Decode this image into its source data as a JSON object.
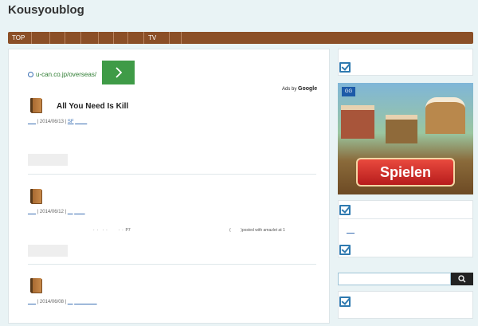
{
  "site": {
    "title": "Kousyoublog"
  },
  "nav": {
    "items": [
      "TOP",
      "",
      "",
      "",
      "",
      "",
      "",
      "",
      "TV",
      ""
    ]
  },
  "ad": {
    "url": "u-can.co.jp/overseas/",
    "ads_by_prefix": "Ads by",
    "ads_by_brand": "Google",
    "button_icon": "chevron-right-icon"
  },
  "posts": [
    {
      "title": "All You Need Is Kill",
      "date_prefix": "___",
      "date": "| 2014/06/13 |",
      "category": "SF",
      "tags": "___ _"
    },
    {
      "title": "",
      "date_prefix": "___",
      "date": "| 2014/06/12 |",
      "category": "__",
      "tags": "_ _ _",
      "excerpt_left": "·  ·    ·  ·          ·  ·  P7",
      "excerpt_right": "(         )posted with amazlet at 1"
    },
    {
      "title": "",
      "date_prefix": "___",
      "date": "| 2014/06/08 |",
      "category": "__",
      "tags": "_ _ _ _ _ _"
    }
  ],
  "sidebar": {
    "game_ad": {
      "badge": "GG",
      "cta": "Spielen"
    },
    "link": "___",
    "search": {
      "placeholder": "",
      "icon": "search-icon"
    }
  },
  "colors": {
    "nav": "#8b4f27",
    "accent": "#2f7ab0",
    "ad_green": "#3f9b47",
    "cta_red": "#c62828"
  }
}
